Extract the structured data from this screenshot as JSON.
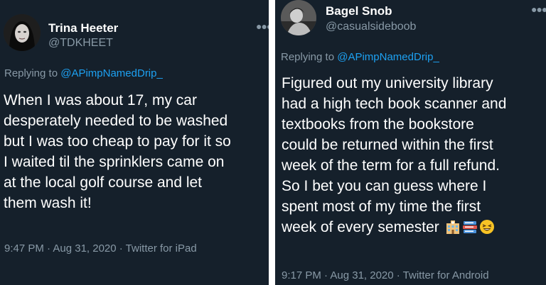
{
  "tweets": [
    {
      "display_name": "Trina Heeter",
      "handle": "@TDKHEET",
      "replying_prefix": "Replying to ",
      "replying_to": "@APimpNamedDrip_",
      "lines": [
        "When I was about 17, my car",
        "desperately needed to be washed",
        "but I was too cheap to pay for it so",
        "I waited til the sprinklers came on",
        "at the local golf course and let",
        "them wash it!"
      ],
      "timestamp": "9:47 PM · Aug 31, 2020 · Twitter for iPad",
      "avatar_icon": "user-avatar",
      "more_icon": "more-options-icon"
    },
    {
      "display_name": "Bagel Snob",
      "handle": "@casualsideboob",
      "replying_prefix": "Replying to ",
      "replying_to": "@APimpNamedDrip_",
      "lines": [
        "Figured out my university library",
        "had a high tech book scanner and",
        "textbooks from the bookstore",
        "could be returned within the first",
        "week of the term for a full refund.",
        "So I bet you can guess where I",
        "spent most of my time the first",
        "week of every semester"
      ],
      "emoji_icons": [
        "school-building-icon",
        "books-icon",
        "grinning-squinting-face-icon"
      ],
      "timestamp": "9:17 PM · Aug 31, 2020 · Twitter for Android",
      "avatar_icon": "user-avatar",
      "more_icon": "more-options-icon"
    }
  ],
  "colors": {
    "background": "#15202b",
    "text": "#ffffff",
    "secondary": "#8899a6",
    "link": "#1da1f2",
    "separator": "#ffffff"
  }
}
